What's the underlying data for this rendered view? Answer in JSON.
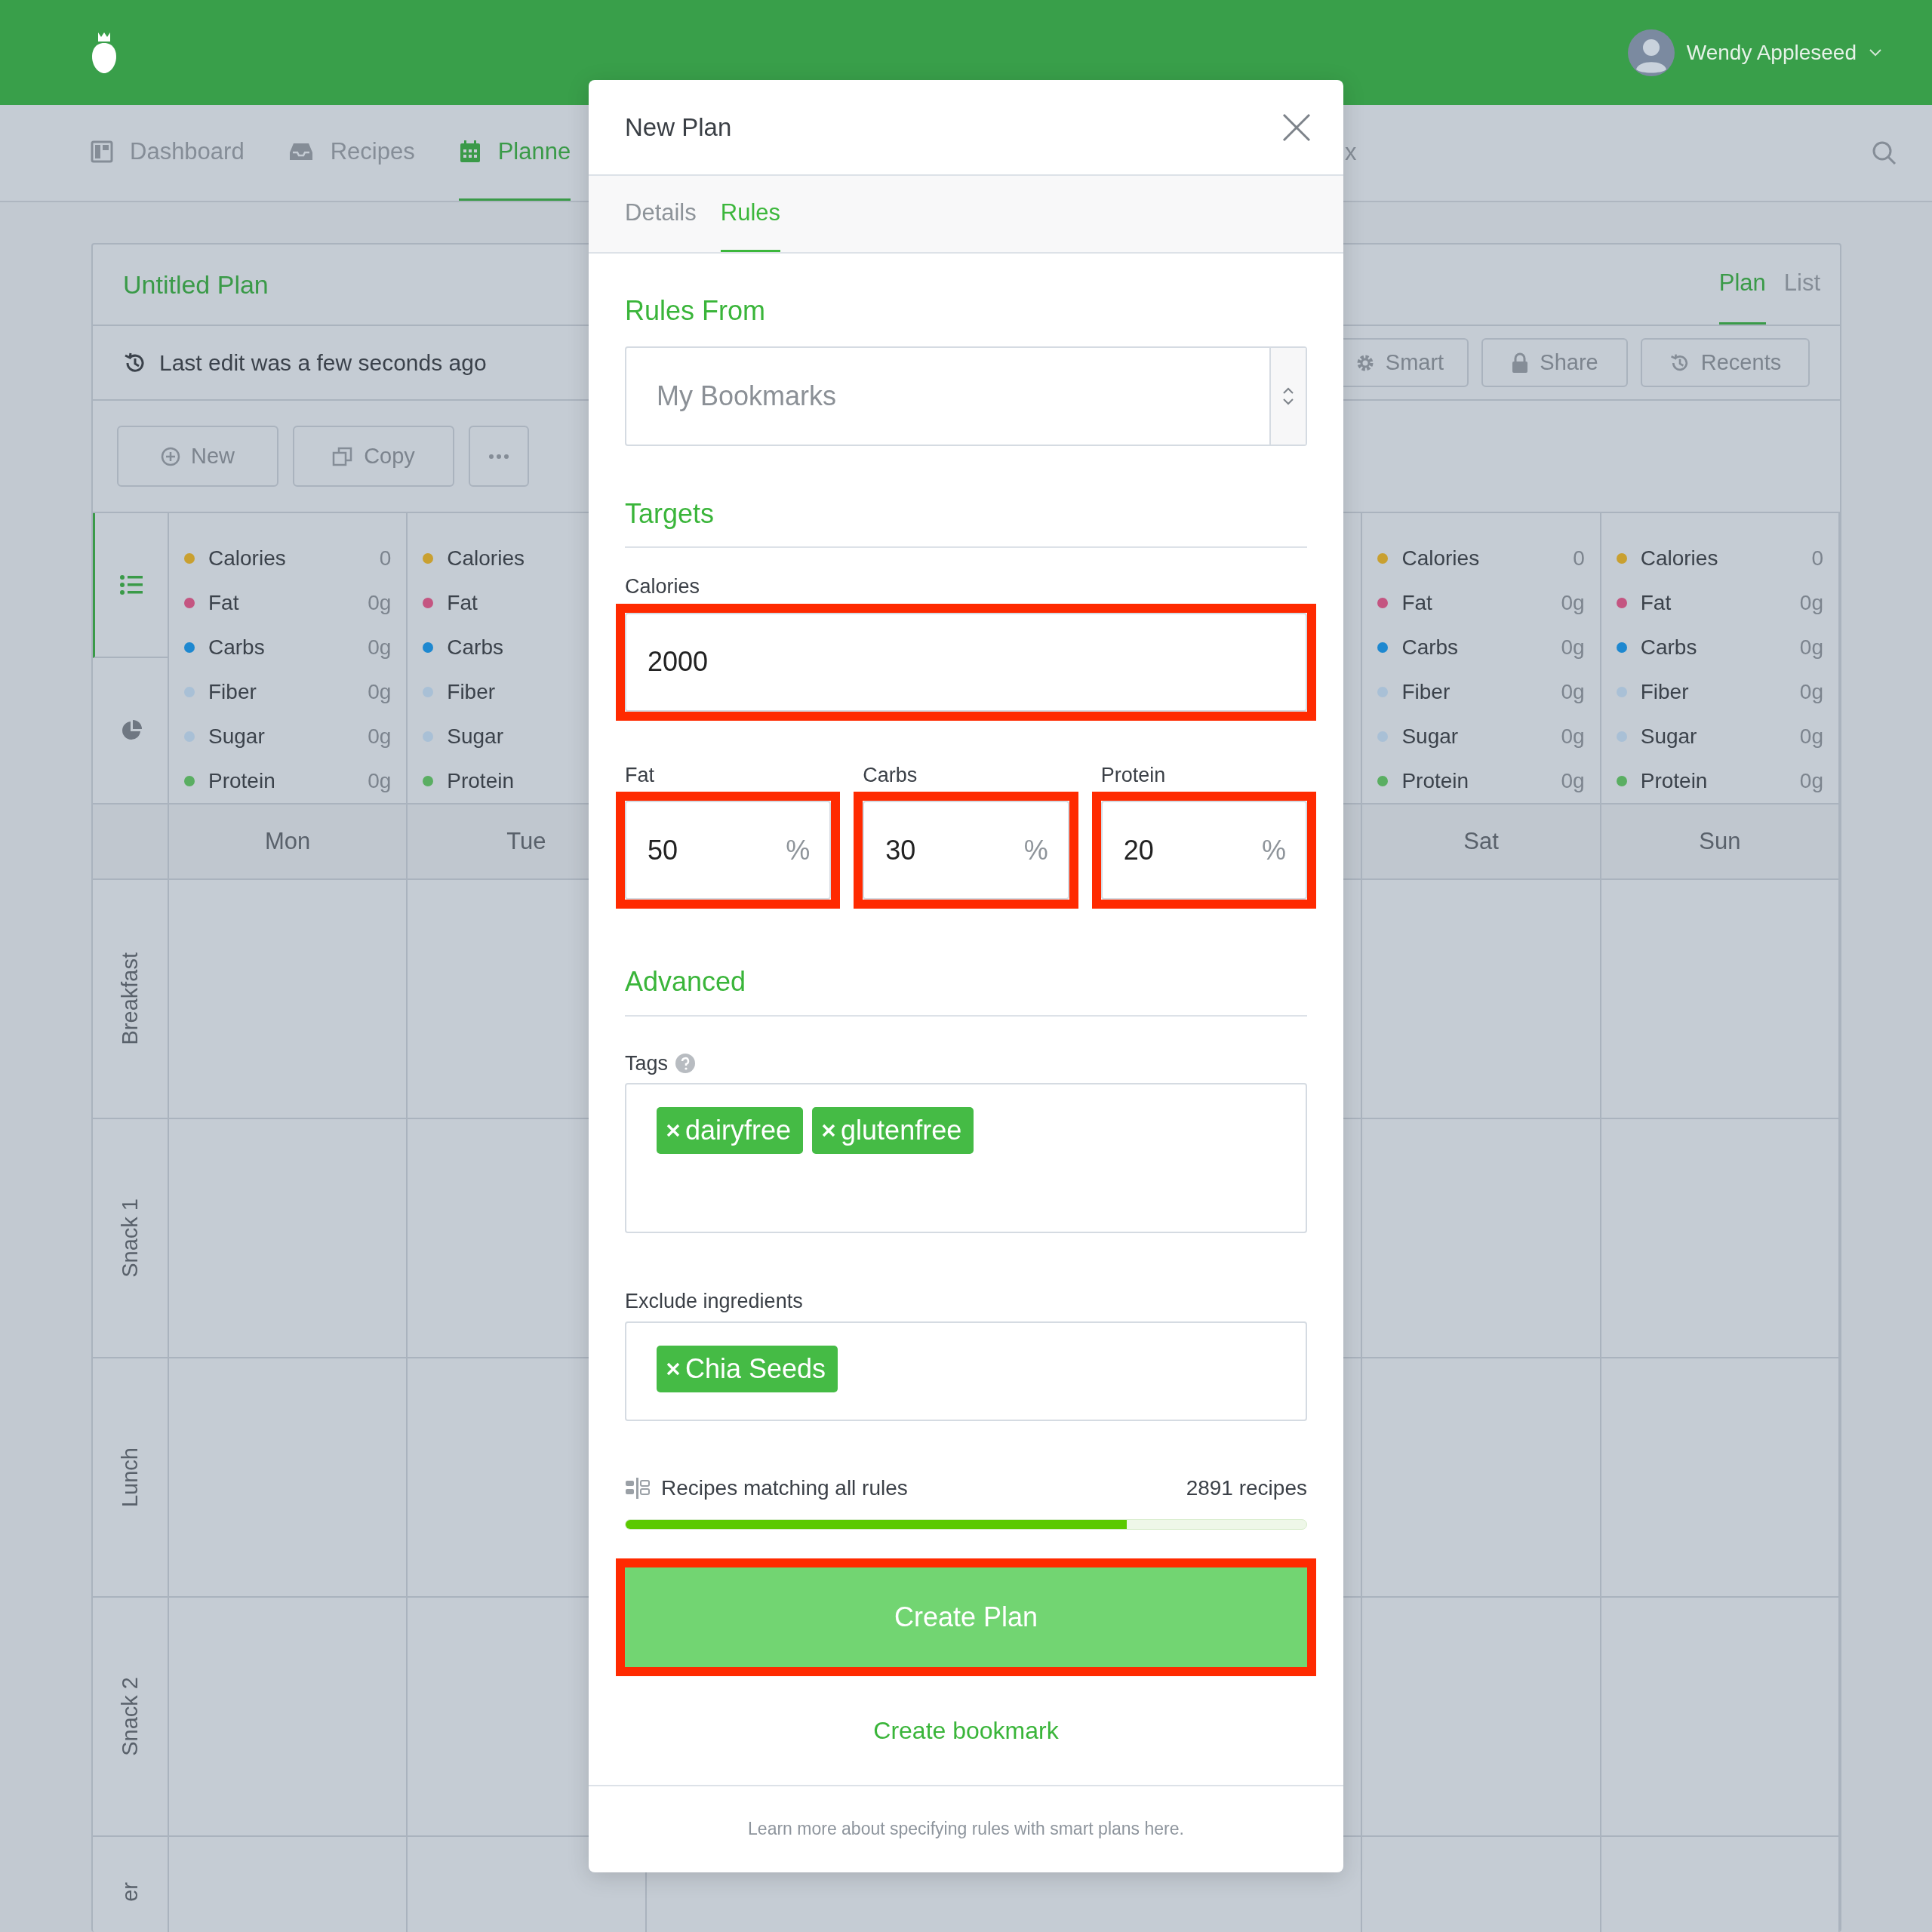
{
  "header": {
    "user_name": "Wendy Appleseed"
  },
  "nav": [
    {
      "label": "Dashboard",
      "selected": false
    },
    {
      "label": "Recipes",
      "selected": false
    },
    {
      "label": "Planne",
      "selected": true
    }
  ],
  "nav_partial": "x",
  "plan": {
    "title": "Untitled Plan",
    "view_tabs": [
      {
        "label": "Plan",
        "selected": true
      },
      {
        "label": "List",
        "selected": false
      }
    ],
    "last_edit": "Last edit was a few seconds ago",
    "actions": [
      "Smart",
      "Share",
      "Recents"
    ],
    "toolbar": [
      "New",
      "Copy"
    ],
    "side_tabs": [
      {
        "selected": true
      },
      {
        "selected": false
      }
    ],
    "days_left": [
      {
        "name": "Mon",
        "nutrients": [
          {
            "label": "Calories",
            "value": "0",
            "color": "#c9a030"
          },
          {
            "label": "Fat",
            "value": "0g",
            "color": "#c45581"
          },
          {
            "label": "Carbs",
            "value": "0g",
            "color": "#1e88d0"
          },
          {
            "label": "Fiber",
            "value": "0g",
            "color": "#a9c0d6"
          },
          {
            "label": "Sugar",
            "value": "0g",
            "color": "#a9c0d6"
          },
          {
            "label": "Protein",
            "value": "0g",
            "color": "#5aae62"
          }
        ]
      },
      {
        "name": "Tue",
        "nutrients": [
          {
            "label": "Calories",
            "color": "#c9a030"
          },
          {
            "label": "Fat",
            "color": "#c45581"
          },
          {
            "label": "Carbs",
            "color": "#1e88d0"
          },
          {
            "label": "Fiber",
            "color": "#a9c0d6"
          },
          {
            "label": "Sugar",
            "color": "#a9c0d6"
          },
          {
            "label": "Protein",
            "color": "#5aae62"
          }
        ]
      }
    ],
    "days_right": [
      {
        "name": "Sat",
        "nutrients": [
          {
            "label": "Calories",
            "value": "0",
            "color": "#c9a030"
          },
          {
            "label": "Fat",
            "value": "0g",
            "color": "#c45581"
          },
          {
            "label": "Carbs",
            "value": "0g",
            "color": "#1e88d0"
          },
          {
            "label": "Fiber",
            "value": "0g",
            "color": "#a9c0d6"
          },
          {
            "label": "Sugar",
            "value": "0g",
            "color": "#a9c0d6"
          },
          {
            "label": "Protein",
            "value": "0g",
            "color": "#5aae62"
          }
        ]
      },
      {
        "name": "Sun",
        "nutrients": [
          {
            "label": "Calories",
            "value": "0",
            "color": "#c9a030"
          },
          {
            "label": "Fat",
            "value": "0g",
            "color": "#c45581"
          },
          {
            "label": "Carbs",
            "value": "0g",
            "color": "#1e88d0"
          },
          {
            "label": "Fiber",
            "value": "0g",
            "color": "#a9c0d6"
          },
          {
            "label": "Sugar",
            "value": "0g",
            "color": "#a9c0d6"
          },
          {
            "label": "Protein",
            "value": "0g",
            "color": "#5aae62"
          }
        ]
      }
    ],
    "meals": [
      "Breakfast",
      "Snack 1",
      "Lunch",
      "Snack 2",
      "er"
    ]
  },
  "modal": {
    "title": "New Plan",
    "tabs": [
      {
        "label": "Details",
        "selected": false
      },
      {
        "label": "Rules",
        "selected": true
      }
    ],
    "rules_from": {
      "heading": "Rules From",
      "placeholder": "My Bookmarks"
    },
    "targets": {
      "heading": "Targets",
      "calories": {
        "label": "Calories",
        "value": "2000",
        "highlighted": true
      },
      "macros": [
        {
          "label": "Fat",
          "value": "50",
          "unit": "%",
          "highlighted": true
        },
        {
          "label": "Carbs",
          "value": "30",
          "unit": "%",
          "highlighted": true
        },
        {
          "label": "Protein",
          "value": "20",
          "unit": "%",
          "highlighted": true
        }
      ]
    },
    "advanced": {
      "heading": "Advanced",
      "tags": {
        "label": "Tags",
        "chips": [
          "dairyfree",
          "glutenfree"
        ]
      },
      "exclude": {
        "label": "Exclude ingredients",
        "chips": [
          "Chia Seeds"
        ]
      }
    },
    "matching": {
      "label": "Recipes matching all rules",
      "count": "2891 recipes",
      "level": 0.736
    },
    "create_button": {
      "label": "Create Plan",
      "highlighted": true
    },
    "bookmark_link": "Create bookmark",
    "footer": {
      "before": "Learn more about specifying rules with smart plans ",
      "link": "here",
      "after": "."
    }
  }
}
